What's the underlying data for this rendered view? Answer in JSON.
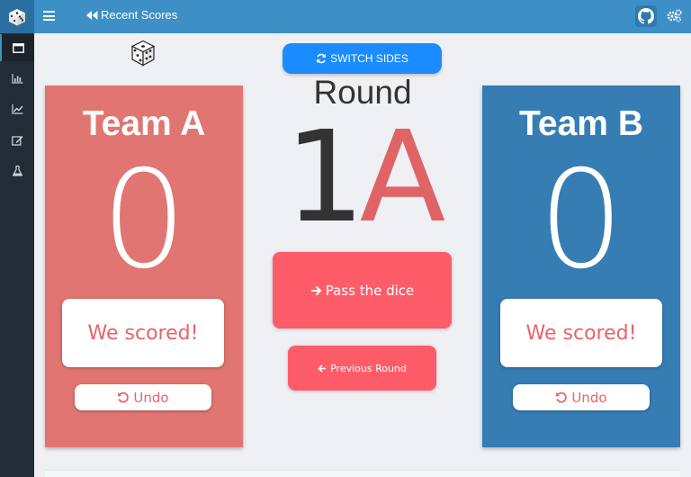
{
  "header": {
    "recent_label": "Recent Scores"
  },
  "sidebar": {
    "items": [
      {
        "icon": "window-icon",
        "active": true
      },
      {
        "icon": "bar-chart-icon",
        "active": false
      },
      {
        "icon": "line-chart-icon",
        "active": false
      },
      {
        "icon": "edit-icon",
        "active": false
      },
      {
        "icon": "flask-icon",
        "active": false
      }
    ]
  },
  "controls": {
    "switch_label": "SWITCH SIDES",
    "pass_label": "Pass the dice",
    "previous_label": "Previous Round"
  },
  "round": {
    "label": "Round",
    "number": "1",
    "side": "A"
  },
  "team_a": {
    "name": "Team A",
    "score": "0",
    "scored_label": "We scored!",
    "undo_label": "Undo"
  },
  "team_b": {
    "name": "Team B",
    "score": "0",
    "scored_label": "We scored!",
    "undo_label": "Undo"
  },
  "colors": {
    "team_a": "#e07571",
    "team_b": "#367db4",
    "accent": "#ff5c6a",
    "switch": "#1a8cff",
    "topbar": "#3d8fc6",
    "sidebar": "#222c36"
  }
}
